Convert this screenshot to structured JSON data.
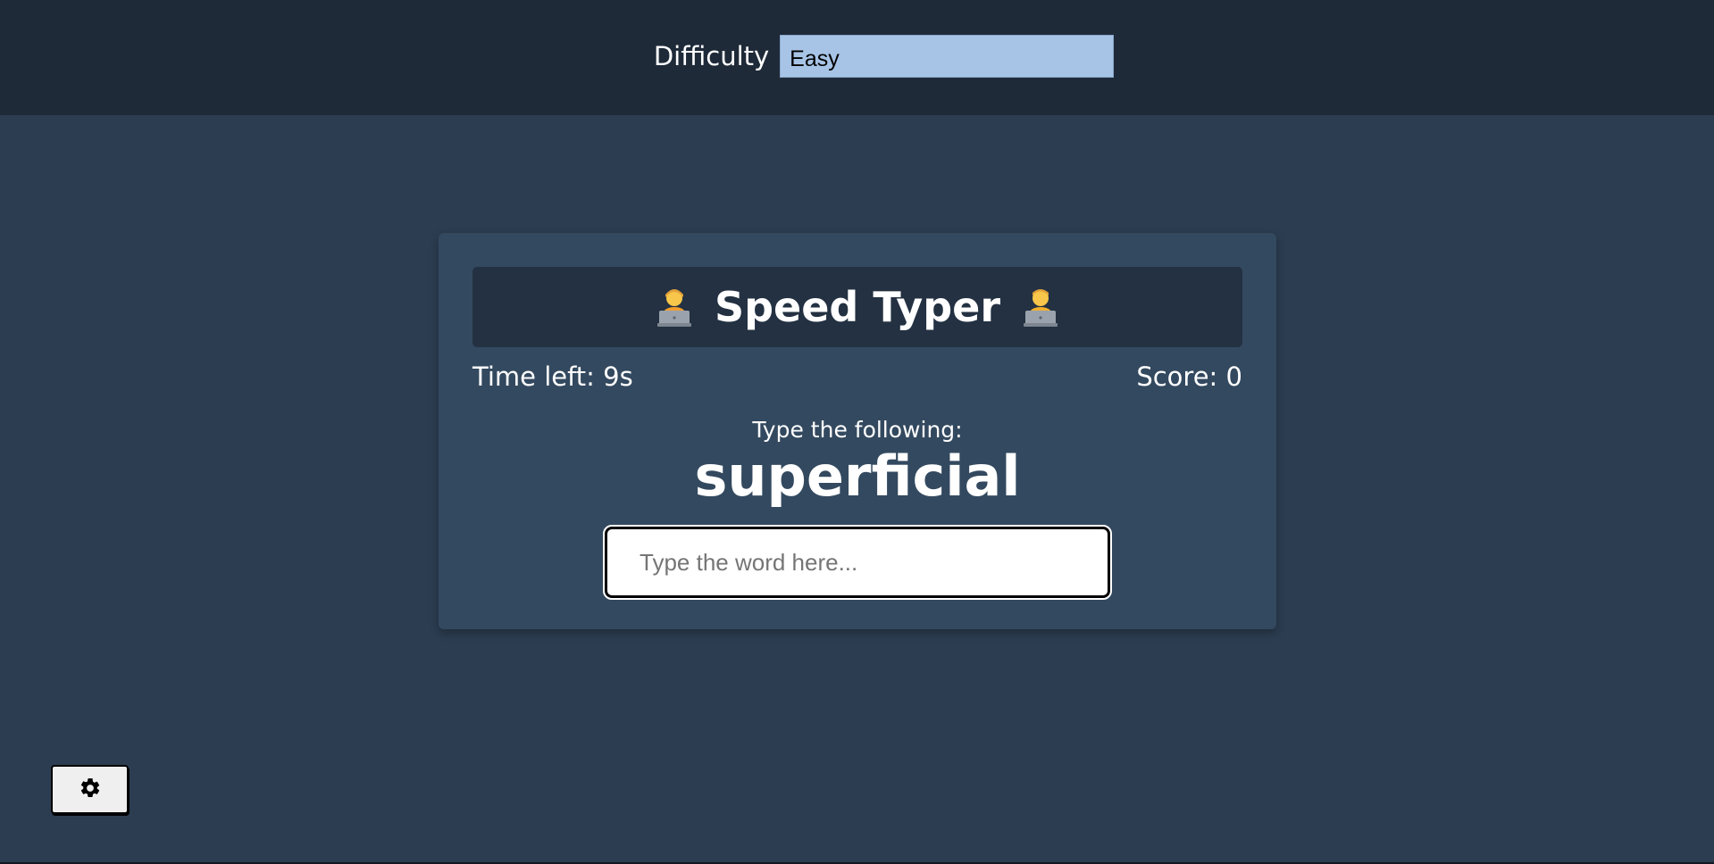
{
  "top_bar": {
    "difficulty_label": "Difficulty",
    "difficulty_value": "Easy"
  },
  "game": {
    "title": "Speed Typer",
    "icons": [
      "woman-technologist-icon",
      "man-technologist-icon"
    ],
    "time_left": "Time left: 9s",
    "score": "Score: 0",
    "prompt": "Type the following:",
    "word": "superficial",
    "input_placeholder": "Type the word here...",
    "input_value": ""
  },
  "settings": {
    "icon": "gear-icon"
  },
  "colors": {
    "page_background": "#2c3d51",
    "top_bar_background": "#1f2a39",
    "card_background": "#33495f",
    "title_bar_background": "#233142",
    "select_background": "#a7c4e6"
  }
}
